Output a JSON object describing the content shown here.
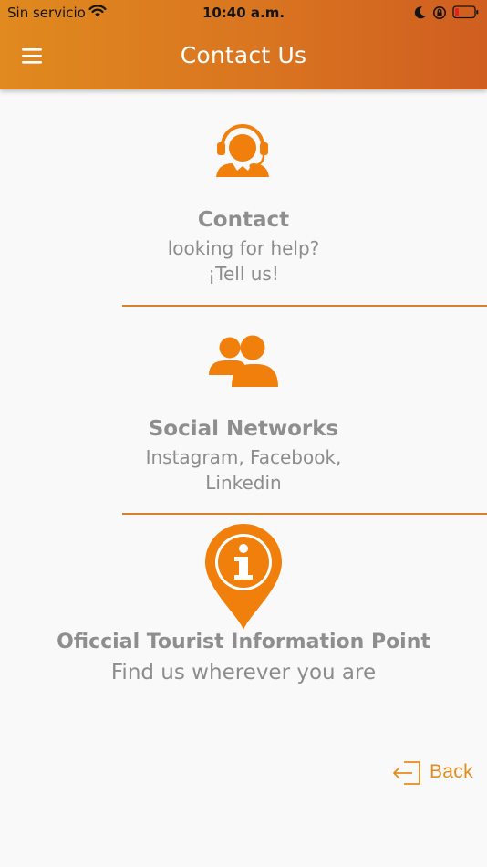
{
  "status_bar": {
    "carrier": "Sin servicio",
    "time": "10:40 a.m.",
    "icons": [
      "wifi-icon",
      "moon-icon",
      "orientation-lock-icon",
      "battery-icon"
    ]
  },
  "header": {
    "title": "Contact Us",
    "menu_icon": "hamburger-menu-icon"
  },
  "sections": [
    {
      "icon": "headset-support-icon",
      "title": "Contact",
      "lines": [
        "looking for help?",
        "¡Tell us!"
      ]
    },
    {
      "icon": "people-group-icon",
      "title": "Social Networks",
      "lines": [
        "Instagram, Facebook,",
        "Linkedin"
      ]
    },
    {
      "icon": "info-location-pin-icon",
      "title": "Oficcial Tourist Information Point",
      "lines": [
        "Find us wherever you are"
      ]
    }
  ],
  "back": {
    "label": "Back",
    "icon": "back-arrow-icon"
  },
  "colors": {
    "accent": "#f07f0c",
    "header_start": "#e08a1f",
    "header_end": "#cf5e20",
    "text_gray": "#8e8e8e",
    "background": "#f9f9f9"
  }
}
